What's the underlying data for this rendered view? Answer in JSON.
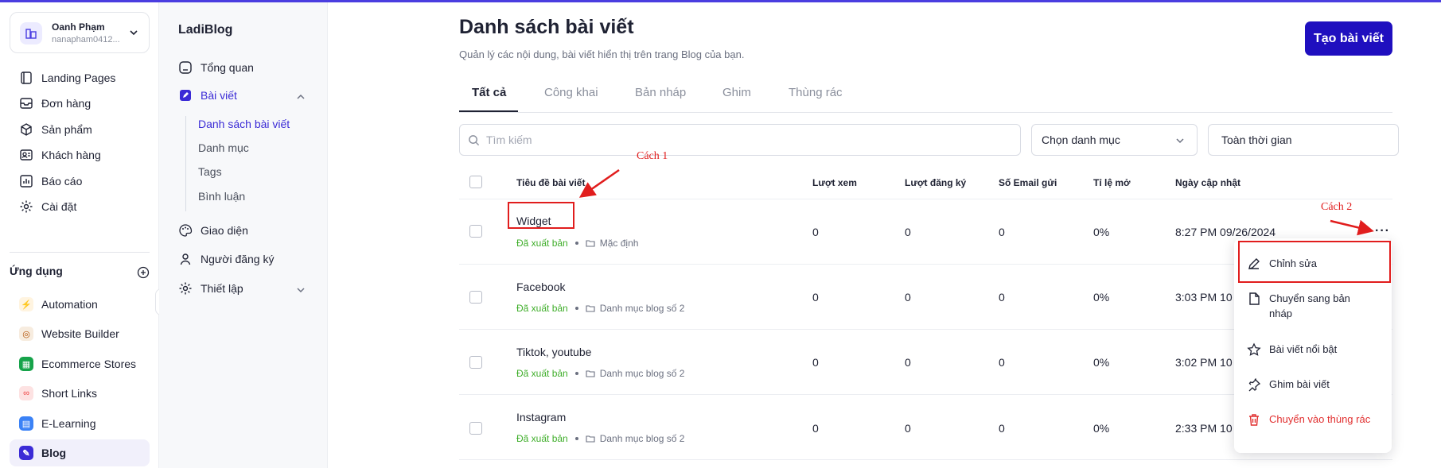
{
  "colors": {
    "accent": "#1f0fbf",
    "active_text": "#3b2bd6",
    "published": "#3fae2a",
    "danger": "#e12f2f",
    "annotation": "#e11d1d"
  },
  "account": {
    "name": "Oanh Phạm",
    "email": "nanapham0412...",
    "avatar_icon": "building-icon"
  },
  "nav": {
    "items": [
      {
        "label": "Landing Pages",
        "icon": "pages-icon"
      },
      {
        "label": "Đơn hàng",
        "icon": "inbox-icon"
      },
      {
        "label": "Sản phẩm",
        "icon": "box-icon"
      },
      {
        "label": "Khách hàng",
        "icon": "contact-card-icon"
      },
      {
        "label": "Báo cáo",
        "icon": "report-icon"
      },
      {
        "label": "Cài đặt",
        "icon": "gear-icon"
      }
    ],
    "apps_title": "Ứng dụng",
    "apps": [
      {
        "label": "Automation",
        "icon": "bolt-icon",
        "color": "#f59e0b"
      },
      {
        "label": "Website Builder",
        "icon": "globe-icon",
        "color": "#b45309"
      },
      {
        "label": "Ecommerce Stores",
        "icon": "store-icon",
        "color": "#16a34a"
      },
      {
        "label": "Short Links",
        "icon": "link-icon",
        "color": "#ef4444"
      },
      {
        "label": "E-Learning",
        "icon": "book-icon",
        "color": "#3b82f6"
      },
      {
        "label": "Blog",
        "icon": "blog-icon",
        "color": "#3b2bd6"
      }
    ]
  },
  "sub": {
    "title": "LadiBlog",
    "items": [
      {
        "label": "Tổng quan"
      },
      {
        "label": "Bài viết"
      },
      {
        "label": "Giao diện"
      },
      {
        "label": "Người đăng ký"
      },
      {
        "label": "Thiết lập"
      }
    ],
    "children": [
      "Danh sách bài viết",
      "Danh mục",
      "Tags",
      "Bình luận"
    ]
  },
  "page": {
    "title": "Danh sách bài viết",
    "subtitle": "Quản lý các nội dung, bài viết hiển thị trên trang Blog của bạn.",
    "create_label": "Tạo bài viết"
  },
  "tabs": [
    "Tất cả",
    "Công khai",
    "Bản nháp",
    "Ghim",
    "Thùng rác"
  ],
  "filters": {
    "search_placeholder": "Tìm kiếm",
    "category_label": "Chọn danh mục",
    "time_label": "Toàn thời gian"
  },
  "table": {
    "headers": [
      "Tiêu đề bài viết",
      "Lượt xem",
      "Lượt đăng ký",
      "Số Email gửi",
      "Tỉ lệ mở",
      "Ngày cập nhật"
    ],
    "rows": [
      {
        "title": "Widget",
        "status": "Đã xuất bản",
        "category": "Mặc định",
        "views": "0",
        "subs": "0",
        "emails": "0",
        "open_rate": "0%",
        "updated": "8:27 PM 09/26/2024"
      },
      {
        "title": "Facebook",
        "status": "Đã xuất bản",
        "category": "Danh mục blog số 2",
        "views": "0",
        "subs": "0",
        "emails": "0",
        "open_rate": "0%",
        "updated": "3:03 PM 10"
      },
      {
        "title": "Tiktok, youtube",
        "status": "Đã xuất bản",
        "category": "Danh mục blog số 2",
        "views": "0",
        "subs": "0",
        "emails": "0",
        "open_rate": "0%",
        "updated": "3:02 PM 10"
      },
      {
        "title": "Instagram",
        "status": "Đã xuất bản",
        "category": "Danh mục blog số 2",
        "views": "0",
        "subs": "0",
        "emails": "0",
        "open_rate": "0%",
        "updated": "2:33 PM 10"
      }
    ],
    "more_label": "···"
  },
  "menu": {
    "items": [
      {
        "label": "Chỉnh sửa",
        "icon": "pencil-icon"
      },
      {
        "label": "Chuyển sang bản nháp",
        "icon": "draft-icon"
      },
      {
        "label": "Bài viết nổi bật",
        "icon": "star-icon"
      },
      {
        "label": "Ghim bài viết",
        "icon": "pin-icon"
      },
      {
        "label": "Chuyển vào thùng rác",
        "icon": "trash-icon"
      }
    ]
  },
  "annotations": {
    "cach1": "Cách 1",
    "cach2": "Cách 2"
  }
}
